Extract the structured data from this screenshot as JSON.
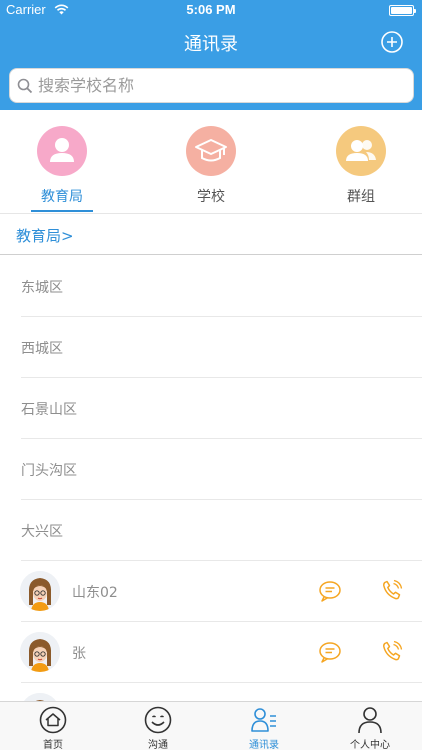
{
  "status_bar": {
    "carrier": "Carrier",
    "time": "5:06 PM"
  },
  "nav": {
    "title": "通讯录",
    "add_icon": "plus-circle-icon"
  },
  "search": {
    "placeholder": "搜索学校名称",
    "value": ""
  },
  "tabs": [
    {
      "label": "教育局",
      "icon": "person-icon",
      "color": "#f7a9c9",
      "active": true
    },
    {
      "label": "学校",
      "icon": "graduation-cap-icon",
      "color": "#f5b0a2",
      "active": false
    },
    {
      "label": "群组",
      "icon": "group-icon",
      "color": "#f5c97e",
      "active": false
    }
  ],
  "breadcrumb": "教育局>",
  "districts": [
    "东城区",
    "西城区",
    "石景山区",
    "门头沟区",
    "大兴区"
  ],
  "contacts": [
    {
      "name": "山东02"
    },
    {
      "name": "张"
    }
  ],
  "tabbar": [
    {
      "label": "首页",
      "icon": "home-icon",
      "active": false
    },
    {
      "label": "沟通",
      "icon": "smile-chat-icon",
      "active": false
    },
    {
      "label": "通讯录",
      "icon": "contacts-icon",
      "active": true
    },
    {
      "label": "个人中心",
      "icon": "user-profile-icon",
      "active": false
    }
  ],
  "colors": {
    "primary": "#3a9ee5",
    "accent_text": "#2f8fd8",
    "action_icon": "#f5a623"
  }
}
